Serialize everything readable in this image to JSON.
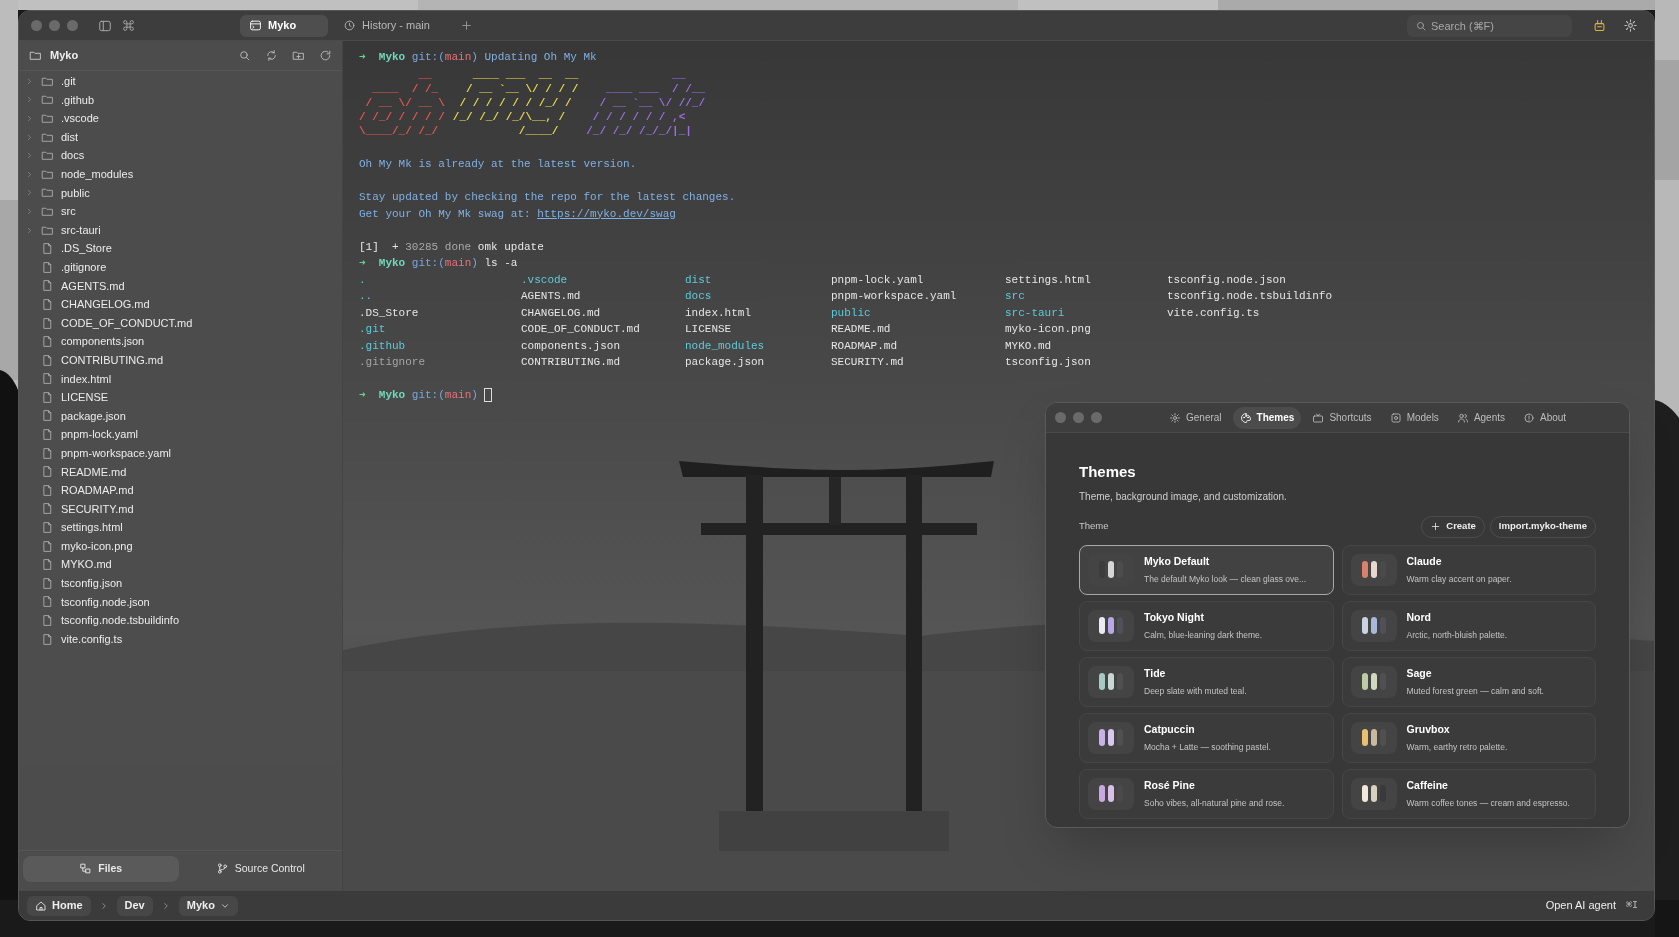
{
  "titlebar": {
    "tabs": [
      {
        "label": "Myko",
        "selected": true,
        "kind": "terminal"
      },
      {
        "label": "History - main",
        "selected": false,
        "kind": "history"
      }
    ],
    "search": {
      "placeholder": "Search (⌘F)"
    }
  },
  "sidebar": {
    "title": "Myko",
    "items": [
      {
        "name": ".git",
        "kind": "folder",
        "expanded": false
      },
      {
        "name": ".github",
        "kind": "folder",
        "expanded": false
      },
      {
        "name": ".vscode",
        "kind": "folder",
        "expanded": false
      },
      {
        "name": "dist",
        "kind": "folder",
        "expanded": false
      },
      {
        "name": "docs",
        "kind": "folder",
        "expanded": false
      },
      {
        "name": "node_modules",
        "kind": "folder",
        "expanded": false
      },
      {
        "name": "public",
        "kind": "folder",
        "expanded": false
      },
      {
        "name": "src",
        "kind": "folder",
        "expanded": false
      },
      {
        "name": "src-tauri",
        "kind": "folder",
        "expanded": false
      },
      {
        "name": ".DS_Store",
        "kind": "file"
      },
      {
        "name": ".gitignore",
        "kind": "file"
      },
      {
        "name": "AGENTS.md",
        "kind": "file"
      },
      {
        "name": "CHANGELOG.md",
        "kind": "file"
      },
      {
        "name": "CODE_OF_CONDUCT.md",
        "kind": "file"
      },
      {
        "name": "components.json",
        "kind": "file"
      },
      {
        "name": "CONTRIBUTING.md",
        "kind": "file"
      },
      {
        "name": "index.html",
        "kind": "file"
      },
      {
        "name": "LICENSE",
        "kind": "file"
      },
      {
        "name": "package.json",
        "kind": "file"
      },
      {
        "name": "pnpm-lock.yaml",
        "kind": "file"
      },
      {
        "name": "pnpm-workspace.yaml",
        "kind": "file"
      },
      {
        "name": "README.md",
        "kind": "file"
      },
      {
        "name": "ROADMAP.md",
        "kind": "file"
      },
      {
        "name": "SECURITY.md",
        "kind": "file"
      },
      {
        "name": "settings.html",
        "kind": "file"
      },
      {
        "name": "myko-icon.png",
        "kind": "file"
      },
      {
        "name": "MYKO.md",
        "kind": "file"
      },
      {
        "name": "tsconfig.json",
        "kind": "file"
      },
      {
        "name": "tsconfig.node.json",
        "kind": "file"
      },
      {
        "name": "tsconfig.node.tsbuildinfo",
        "kind": "file"
      },
      {
        "name": "vite.config.ts",
        "kind": "file"
      }
    ],
    "tabs": [
      {
        "label": "Files",
        "selected": true,
        "kind": "files"
      },
      {
        "label": "Source Control",
        "selected": false,
        "kind": "source"
      }
    ]
  },
  "terminal": {
    "blocks": [
      {
        "kind": "line",
        "spans": [
          {
            "kind": "arrow",
            "text": "➜"
          },
          {
            "kind": "user",
            "text": "Myko"
          },
          {
            "kind": "git_open",
            "text": "git:("
          },
          {
            "kind": "branch",
            "text": "main"
          },
          {
            "kind": "git_close",
            "text": ")"
          },
          {
            "kind": "info",
            "text": "Updating Oh My Mk"
          }
        ]
      },
      {
        "kind": "art",
        "segments": [
          {
            "color": "#e0574f",
            "text": "         __\n  ____  / /_\n / __ \\/ __ \\\n/ /_/ / / / /\n\\____/_/ /_/"
          },
          {
            "color": "#e6d84a",
            "text": "   ____ ___  __  __\n  / __ `__ \\/ / / /\n / / / / / / /_/ /\n/_/ /_/ /_/\\__, /\n          /____/"
          },
          {
            "color": "#9a6fe0",
            "text": "             __\n   ____ ___  / /__\n  / __ `__ \\/ //_/\n / / / / / / ,<\n/_/ /_/ /_/_/|_|"
          }
        ]
      },
      {
        "kind": "blank"
      },
      {
        "kind": "line",
        "spans": [
          {
            "kind": "info",
            "text": "Oh My Mk is already at the latest version."
          }
        ]
      },
      {
        "kind": "blank"
      },
      {
        "kind": "line",
        "spans": [
          {
            "kind": "info",
            "text": "Stay updated by checking the repo for the latest changes."
          }
        ]
      },
      {
        "kind": "line",
        "spans": [
          {
            "kind": "info",
            "text": "Get your Oh My Mk swag at:"
          },
          {
            "kind": "link",
            "text": "https://myko.dev/swag"
          }
        ]
      },
      {
        "kind": "blank"
      },
      {
        "kind": "line",
        "spans": [
          {
            "kind": "plain",
            "text": "[1]  +"
          },
          {
            "kind": "dim",
            "text": "30285 done"
          },
          {
            "kind": "plain",
            "text": "omk update"
          }
        ]
      },
      {
        "kind": "line",
        "spans": [
          {
            "kind": "arrow",
            "text": "➜"
          },
          {
            "kind": "user",
            "text": "Myko"
          },
          {
            "kind": "git_open",
            "text": "git:("
          },
          {
            "kind": "branch",
            "text": "main"
          },
          {
            "kind": "git_close",
            "text": ")"
          },
          {
            "kind": "plain",
            "text": "ls -a"
          }
        ]
      },
      {
        "kind": "listing",
        "columns": [
          [
            {
              "text": ".",
              "kind": "dir"
            },
            {
              "text": "..",
              "kind": "dir"
            },
            {
              "text": ".DS_Store",
              "kind": "file"
            },
            {
              "text": ".git",
              "kind": "dir"
            },
            {
              "text": ".github",
              "kind": "dir"
            },
            {
              "text": ".gitignore",
              "kind": "dim"
            }
          ],
          [
            {
              "text": ".vscode",
              "kind": "dir"
            },
            {
              "text": "AGENTS.md",
              "kind": "file"
            },
            {
              "text": "CHANGELOG.md",
              "kind": "file"
            },
            {
              "text": "CODE_OF_CONDUCT.md",
              "kind": "file"
            },
            {
              "text": "components.json",
              "kind": "file"
            },
            {
              "text": "CONTRIBUTING.md",
              "kind": "file"
            }
          ],
          [
            {
              "text": "dist",
              "kind": "dir"
            },
            {
              "text": "docs",
              "kind": "dir"
            },
            {
              "text": "index.html",
              "kind": "file"
            },
            {
              "text": "LICENSE",
              "kind": "file"
            },
            {
              "text": "node_modules",
              "kind": "dir"
            },
            {
              "text": "package.json",
              "kind": "file"
            }
          ],
          [
            {
              "text": "pnpm-lock.yaml",
              "kind": "file"
            },
            {
              "text": "pnpm-workspace.yaml",
              "kind": "file"
            },
            {
              "text": "public",
              "kind": "dir"
            },
            {
              "text": "README.md",
              "kind": "file"
            },
            {
              "text": "ROADMAP.md",
              "kind": "file"
            },
            {
              "text": "SECURITY.md",
              "kind": "file"
            }
          ],
          [
            {
              "text": "settings.html",
              "kind": "file"
            },
            {
              "text": "src",
              "kind": "dir"
            },
            {
              "text": "src-tauri",
              "kind": "dir"
            },
            {
              "text": "myko-icon.png",
              "kind": "file"
            },
            {
              "text": "MYKO.md",
              "kind": "file"
            },
            {
              "text": "tsconfig.json",
              "kind": "file"
            }
          ],
          [
            {
              "text": "tsconfig.node.json",
              "kind": "file"
            },
            {
              "text": "tsconfig.node.tsbuildinfo",
              "kind": "file"
            },
            {
              "text": "vite.config.ts",
              "kind": "file"
            }
          ]
        ]
      },
      {
        "kind": "blank"
      },
      {
        "kind": "line",
        "spans": [
          {
            "kind": "arrow",
            "text": "➜"
          },
          {
            "kind": "user",
            "text": "Myko"
          },
          {
            "kind": "git_open",
            "text": "git:("
          },
          {
            "kind": "branch",
            "text": "main"
          },
          {
            "kind": "git_close",
            "text": ")"
          },
          {
            "kind": "cursor"
          }
        ]
      }
    ]
  },
  "bottom_bar": {
    "breadcrumbs": [
      {
        "label": "Home",
        "kind": "home"
      },
      {
        "label": "Dev",
        "kind": "plain"
      },
      {
        "label": "Myko",
        "kind": "menu"
      }
    ],
    "agent_button": {
      "label": "Open AI agent",
      "shortcut": "⌘I"
    }
  },
  "settings_window": {
    "tabs": [
      {
        "label": "General",
        "selected": false,
        "kind": "general"
      },
      {
        "label": "Themes",
        "selected": true,
        "kind": "themes"
      },
      {
        "label": "Shortcuts",
        "selected": false,
        "kind": "shortcuts"
      },
      {
        "label": "Models",
        "selected": false,
        "kind": "models"
      },
      {
        "label": "Agents",
        "selected": false,
        "kind": "agents"
      },
      {
        "label": "About",
        "selected": false,
        "kind": "about"
      }
    ],
    "title": "Themes",
    "description": "Theme, background image, and customization.",
    "section_label": "Theme",
    "buttons": [
      {
        "label": "Create",
        "kind": "create"
      },
      {
        "label": "Import.myko-theme",
        "kind": "import"
      }
    ],
    "themes": [
      {
        "name": "Myko Default",
        "description": "The default Myko look — clean glass ove...",
        "selected": true,
        "swatch": [
          {
            "color": "#3c3c3c"
          },
          {
            "color": "#d6d6d6"
          },
          {
            "color": "#4c4c4c"
          }
        ]
      },
      {
        "name": "Claude",
        "description": "Warm clay accent on paper.",
        "selected": false,
        "swatch": [
          {
            "color": "#d9806f"
          },
          {
            "color": "#e6d6cc"
          },
          {
            "color": "#4a4a4a"
          }
        ]
      },
      {
        "name": "Tokyo Night",
        "description": "Calm, blue-leaning dark theme.",
        "selected": false,
        "swatch": [
          {
            "color": "#eaeaf2"
          },
          {
            "color": "#b8a8e8"
          },
          {
            "color": "#505058"
          }
        ]
      },
      {
        "name": "Nord",
        "description": "Arctic, north-bluish palette.",
        "selected": false,
        "swatch": [
          {
            "color": "#c8d4e0"
          },
          {
            "color": "#a8b8d8"
          },
          {
            "color": "#505058"
          }
        ]
      },
      {
        "name": "Tide",
        "description": "Deep slate with muted teal.",
        "selected": false,
        "swatch": [
          {
            "color": "#a8c8c4"
          },
          {
            "color": "#c8d8d4"
          },
          {
            "color": "#505050"
          }
        ]
      },
      {
        "name": "Sage",
        "description": "Muted forest green — calm and soft.",
        "selected": false,
        "swatch": [
          {
            "color": "#bccca4"
          },
          {
            "color": "#d0d8c0"
          },
          {
            "color": "#505050"
          }
        ]
      },
      {
        "name": "Catpuccin",
        "description": "Mocha + Latte — soothing pastel.",
        "selected": false,
        "swatch": [
          {
            "color": "#c8b0e8"
          },
          {
            "color": "#d8c8f0"
          },
          {
            "color": "#505050"
          }
        ]
      },
      {
        "name": "Gruvbox",
        "description": "Warm, earthy retro palette.",
        "selected": false,
        "swatch": [
          {
            "color": "#e8c070"
          },
          {
            "color": "#c8b8a0"
          },
          {
            "color": "#505050"
          }
        ]
      },
      {
        "name": "Rosé Pine",
        "description": "Soho vibes, all-natural pine and rose.",
        "selected": false,
        "swatch": [
          {
            "color": "#c8a8e0"
          },
          {
            "color": "#d8c0e8"
          },
          {
            "color": "#4a4a4a"
          }
        ]
      },
      {
        "name": "Caffeine",
        "description": "Warm coffee tones — cream and espresso.",
        "selected": false,
        "swatch": [
          {
            "color": "#f0e8d8"
          },
          {
            "color": "#d8d0c0"
          },
          {
            "color": "#3a3a3a"
          }
        ]
      }
    ]
  }
}
